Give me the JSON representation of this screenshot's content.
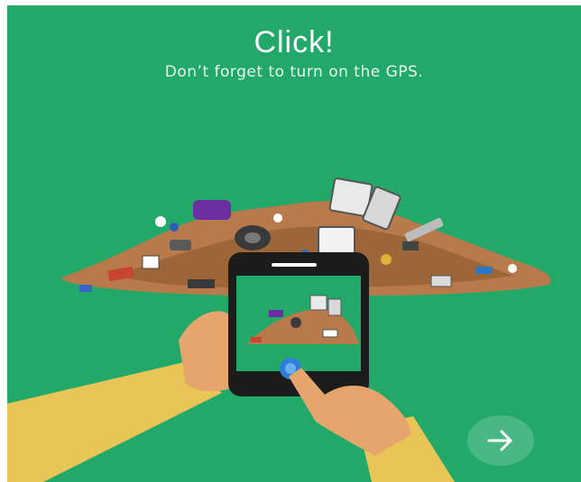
{
  "onboarding": {
    "title": "Click!",
    "subtitle": "Don’t forget to turn on the GPS."
  },
  "next_button": {
    "icon": "arrow-right-icon"
  },
  "colors": {
    "background": "#22a96a",
    "trash_pile": "#b87a4b",
    "sleeve": "#e8c556",
    "skin": "#e7a56e",
    "phone": "#1c1c1c",
    "shutter": "#2f7fd6"
  }
}
